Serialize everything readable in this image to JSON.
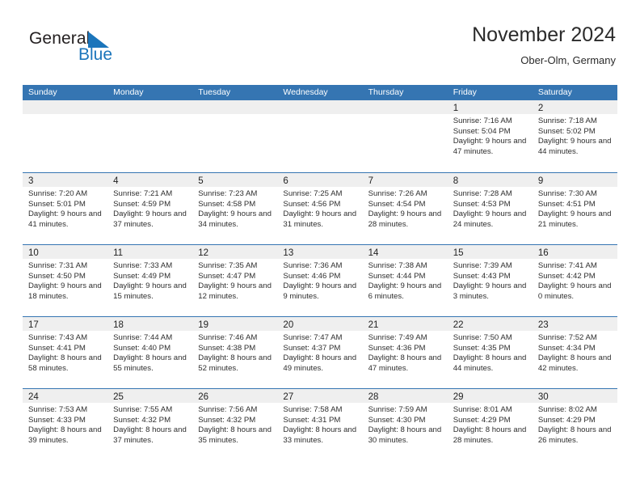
{
  "brand": {
    "name_part1": "General",
    "name_part2": "Blue",
    "flag_color": "#1b75bb",
    "text_color": "#231f20"
  },
  "header": {
    "title": "November 2024",
    "subtitle": "Ober-Olm, Germany"
  },
  "colors": {
    "header_row": "#3575b2",
    "date_band": "#efefef",
    "week_divider": "#3575b2"
  },
  "weekday_headers": [
    "Sunday",
    "Monday",
    "Tuesday",
    "Wednesday",
    "Thursday",
    "Friday",
    "Saturday"
  ],
  "weeks": [
    [
      {
        "date": "",
        "sunrise": "",
        "sunset": "",
        "daylight": ""
      },
      {
        "date": "",
        "sunrise": "",
        "sunset": "",
        "daylight": ""
      },
      {
        "date": "",
        "sunrise": "",
        "sunset": "",
        "daylight": ""
      },
      {
        "date": "",
        "sunrise": "",
        "sunset": "",
        "daylight": ""
      },
      {
        "date": "",
        "sunrise": "",
        "sunset": "",
        "daylight": ""
      },
      {
        "date": "1",
        "sunrise": "Sunrise: 7:16 AM",
        "sunset": "Sunset: 5:04 PM",
        "daylight": "Daylight: 9 hours and 47 minutes."
      },
      {
        "date": "2",
        "sunrise": "Sunrise: 7:18 AM",
        "sunset": "Sunset: 5:02 PM",
        "daylight": "Daylight: 9 hours and 44 minutes."
      }
    ],
    [
      {
        "date": "3",
        "sunrise": "Sunrise: 7:20 AM",
        "sunset": "Sunset: 5:01 PM",
        "daylight": "Daylight: 9 hours and 41 minutes."
      },
      {
        "date": "4",
        "sunrise": "Sunrise: 7:21 AM",
        "sunset": "Sunset: 4:59 PM",
        "daylight": "Daylight: 9 hours and 37 minutes."
      },
      {
        "date": "5",
        "sunrise": "Sunrise: 7:23 AM",
        "sunset": "Sunset: 4:58 PM",
        "daylight": "Daylight: 9 hours and 34 minutes."
      },
      {
        "date": "6",
        "sunrise": "Sunrise: 7:25 AM",
        "sunset": "Sunset: 4:56 PM",
        "daylight": "Daylight: 9 hours and 31 minutes."
      },
      {
        "date": "7",
        "sunrise": "Sunrise: 7:26 AM",
        "sunset": "Sunset: 4:54 PM",
        "daylight": "Daylight: 9 hours and 28 minutes."
      },
      {
        "date": "8",
        "sunrise": "Sunrise: 7:28 AM",
        "sunset": "Sunset: 4:53 PM",
        "daylight": "Daylight: 9 hours and 24 minutes."
      },
      {
        "date": "9",
        "sunrise": "Sunrise: 7:30 AM",
        "sunset": "Sunset: 4:51 PM",
        "daylight": "Daylight: 9 hours and 21 minutes."
      }
    ],
    [
      {
        "date": "10",
        "sunrise": "Sunrise: 7:31 AM",
        "sunset": "Sunset: 4:50 PM",
        "daylight": "Daylight: 9 hours and 18 minutes."
      },
      {
        "date": "11",
        "sunrise": "Sunrise: 7:33 AM",
        "sunset": "Sunset: 4:49 PM",
        "daylight": "Daylight: 9 hours and 15 minutes."
      },
      {
        "date": "12",
        "sunrise": "Sunrise: 7:35 AM",
        "sunset": "Sunset: 4:47 PM",
        "daylight": "Daylight: 9 hours and 12 minutes."
      },
      {
        "date": "13",
        "sunrise": "Sunrise: 7:36 AM",
        "sunset": "Sunset: 4:46 PM",
        "daylight": "Daylight: 9 hours and 9 minutes."
      },
      {
        "date": "14",
        "sunrise": "Sunrise: 7:38 AM",
        "sunset": "Sunset: 4:44 PM",
        "daylight": "Daylight: 9 hours and 6 minutes."
      },
      {
        "date": "15",
        "sunrise": "Sunrise: 7:39 AM",
        "sunset": "Sunset: 4:43 PM",
        "daylight": "Daylight: 9 hours and 3 minutes."
      },
      {
        "date": "16",
        "sunrise": "Sunrise: 7:41 AM",
        "sunset": "Sunset: 4:42 PM",
        "daylight": "Daylight: 9 hours and 0 minutes."
      }
    ],
    [
      {
        "date": "17",
        "sunrise": "Sunrise: 7:43 AM",
        "sunset": "Sunset: 4:41 PM",
        "daylight": "Daylight: 8 hours and 58 minutes."
      },
      {
        "date": "18",
        "sunrise": "Sunrise: 7:44 AM",
        "sunset": "Sunset: 4:40 PM",
        "daylight": "Daylight: 8 hours and 55 minutes."
      },
      {
        "date": "19",
        "sunrise": "Sunrise: 7:46 AM",
        "sunset": "Sunset: 4:38 PM",
        "daylight": "Daylight: 8 hours and 52 minutes."
      },
      {
        "date": "20",
        "sunrise": "Sunrise: 7:47 AM",
        "sunset": "Sunset: 4:37 PM",
        "daylight": "Daylight: 8 hours and 49 minutes."
      },
      {
        "date": "21",
        "sunrise": "Sunrise: 7:49 AM",
        "sunset": "Sunset: 4:36 PM",
        "daylight": "Daylight: 8 hours and 47 minutes."
      },
      {
        "date": "22",
        "sunrise": "Sunrise: 7:50 AM",
        "sunset": "Sunset: 4:35 PM",
        "daylight": "Daylight: 8 hours and 44 minutes."
      },
      {
        "date": "23",
        "sunrise": "Sunrise: 7:52 AM",
        "sunset": "Sunset: 4:34 PM",
        "daylight": "Daylight: 8 hours and 42 minutes."
      }
    ],
    [
      {
        "date": "24",
        "sunrise": "Sunrise: 7:53 AM",
        "sunset": "Sunset: 4:33 PM",
        "daylight": "Daylight: 8 hours and 39 minutes."
      },
      {
        "date": "25",
        "sunrise": "Sunrise: 7:55 AM",
        "sunset": "Sunset: 4:32 PM",
        "daylight": "Daylight: 8 hours and 37 minutes."
      },
      {
        "date": "26",
        "sunrise": "Sunrise: 7:56 AM",
        "sunset": "Sunset: 4:32 PM",
        "daylight": "Daylight: 8 hours and 35 minutes."
      },
      {
        "date": "27",
        "sunrise": "Sunrise: 7:58 AM",
        "sunset": "Sunset: 4:31 PM",
        "daylight": "Daylight: 8 hours and 33 minutes."
      },
      {
        "date": "28",
        "sunrise": "Sunrise: 7:59 AM",
        "sunset": "Sunset: 4:30 PM",
        "daylight": "Daylight: 8 hours and 30 minutes."
      },
      {
        "date": "29",
        "sunrise": "Sunrise: 8:01 AM",
        "sunset": "Sunset: 4:29 PM",
        "daylight": "Daylight: 8 hours and 28 minutes."
      },
      {
        "date": "30",
        "sunrise": "Sunrise: 8:02 AM",
        "sunset": "Sunset: 4:29 PM",
        "daylight": "Daylight: 8 hours and 26 minutes."
      }
    ]
  ]
}
